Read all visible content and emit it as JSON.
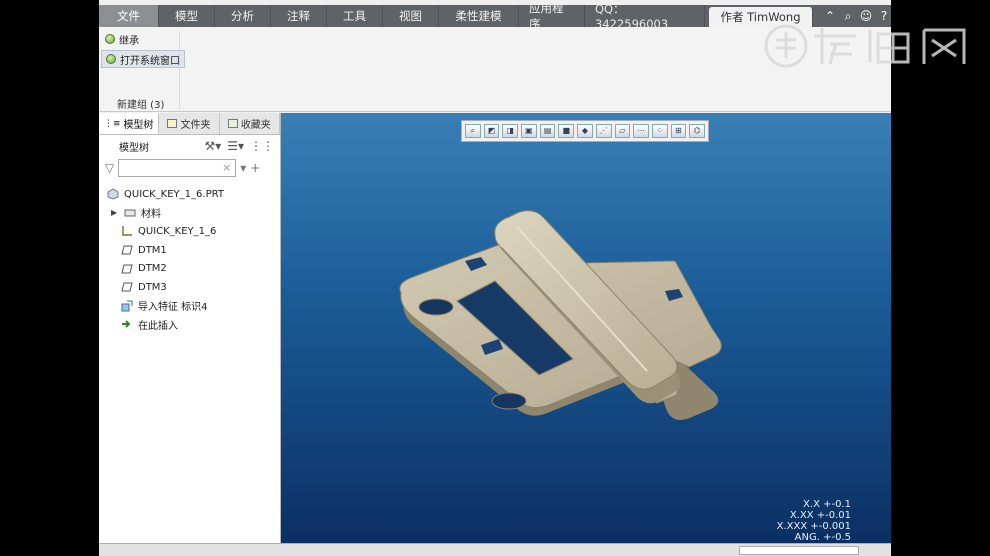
{
  "ribbon_tabs": {
    "file": "文件",
    "model": "模型",
    "analysis": "分析",
    "annotate": "注释",
    "tools": "工具",
    "view": "视图",
    "flexible": "柔性建模",
    "apps": "应用程序",
    "qq": "QQ：3422596003",
    "author": "作者 TimWong"
  },
  "ribbon": {
    "inherit": "继承",
    "open_system_window": "打开系统窗口",
    "group_label": "新建组 (3)"
  },
  "panel": {
    "tabs": [
      "模型树",
      "文件夹",
      "收藏夹"
    ],
    "toolbar_title": "模型树",
    "tree": [
      {
        "label": "QUICK_KEY_1_6.PRT",
        "icon": "part-icon"
      },
      {
        "label": "材料",
        "icon": "material-icon"
      },
      {
        "label": "QUICK_KEY_1_6",
        "icon": "csys-icon"
      },
      {
        "label": "DTM1",
        "icon": "datum-plane-icon"
      },
      {
        "label": "DTM2",
        "icon": "datum-plane-icon"
      },
      {
        "label": "DTM3",
        "icon": "datum-plane-icon"
      },
      {
        "label": "导入特征 标识4",
        "icon": "import-feature-icon"
      },
      {
        "label": "在此插入",
        "icon": "insert-here-icon"
      }
    ]
  },
  "tolerances": [
    "X.X +-0.1",
    "X.XX +-0.01",
    "X.XXX +-0.001",
    "ANG. +-0.5"
  ],
  "colors": {
    "tabbar": "#5f6266",
    "viewport_top": "#3a7fb6",
    "viewport_bottom": "#0b2f63",
    "part": "#bdb39c"
  },
  "watermark_icons": [
    "logo-icon"
  ]
}
